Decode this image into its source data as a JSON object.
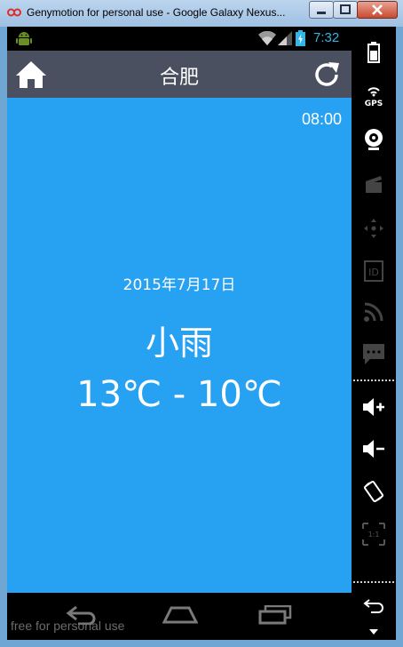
{
  "window": {
    "title": "Genymotion for personal use - Google Galaxy Nexus...",
    "watermark": "free for personal use"
  },
  "statusbar": {
    "time": "7:32",
    "accent": "#33b5e5"
  },
  "actionbar": {
    "city": "合肥",
    "home_icon": "home-icon",
    "refresh_icon": "refresh-icon"
  },
  "weather": {
    "publish_time": "08:00",
    "date": "2015年7月17日",
    "description": "小雨",
    "temperature_range": "13℃ - 10℃"
  },
  "colors": {
    "content_background": "#27a1f2",
    "actionbar_background": "#4b5060",
    "text": "#ffffff"
  },
  "sidebar": {
    "items": [
      "battery-icon",
      "gps-icon",
      "webcam-icon",
      "video-capture-icon",
      "dpad-icon",
      "id-icon",
      "rss-icon",
      "sms-icon",
      "volume-up-icon",
      "volume-down-icon",
      "rotate-icon",
      "scale-icon",
      "back-icon",
      "menu-down-icon"
    ],
    "gps_label": "GPS",
    "id_label": "ID",
    "scale_label": "1:1"
  }
}
